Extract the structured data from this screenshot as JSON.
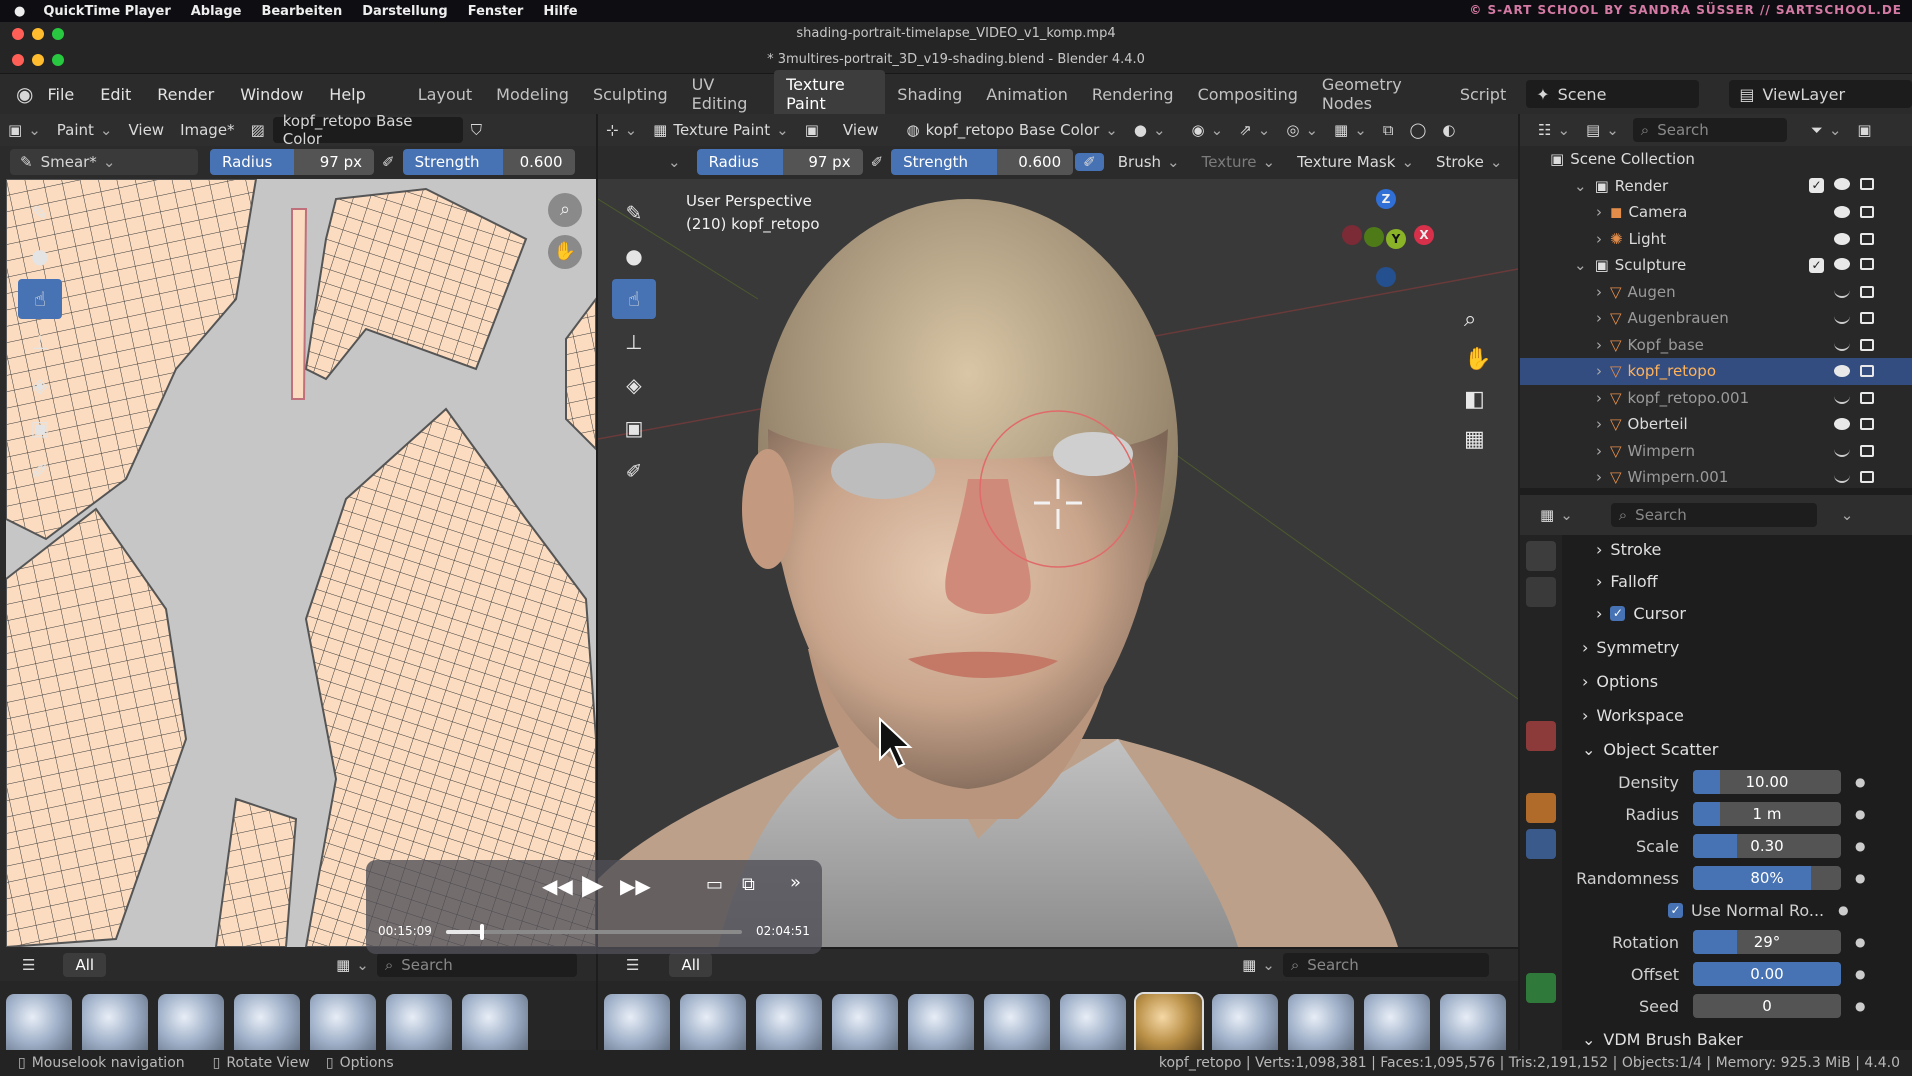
{
  "mac_menubar": {
    "app": "QuickTime Player",
    "items": [
      "Ablage",
      "Bearbeiten",
      "Darstellung",
      "Fenster",
      "Hilfe"
    ],
    "right_text": "© S-ART SCHOOL BY SANDRA SÜSSER // SARTSCHOOL.DE"
  },
  "window": {
    "video_title": "shading-portrait-timelapse_VIDEO_v1_komp.mp4",
    "blender_title": "* 3multires-portrait_3D_v19-shading.blend - Blender 4.4.0"
  },
  "topbar": {
    "menus": [
      "File",
      "Edit",
      "Render",
      "Window",
      "Help"
    ],
    "workspaces": [
      "Layout",
      "Modeling",
      "Sculpting",
      "UV Editing",
      "Texture Paint",
      "Shading",
      "Animation",
      "Rendering",
      "Compositing",
      "Geometry Nodes",
      "Script"
    ],
    "active_workspace": "Texture Paint",
    "scene": "Scene",
    "view_layer": "ViewLayer"
  },
  "image_editor": {
    "mode": "Paint",
    "view": "View",
    "image_menu": "Image*",
    "image_name": "kopf_retopo Base Color",
    "brush": "Smear*",
    "radius_label": "Radius",
    "radius_value": "97 px",
    "strength_label": "Strength",
    "strength_value": "0.600",
    "asset_filter": "All",
    "search_placeholder": "Search"
  },
  "viewport": {
    "mode": "Texture Paint",
    "view": "View",
    "texture": "kopf_retopo Base Color",
    "radius_label": "Radius",
    "radius_value": "97 px",
    "strength_label": "Strength",
    "strength_value": "0.600",
    "brush": "Brush",
    "texture_menu": "Texture",
    "texture_mask": "Texture Mask",
    "stroke": "Stroke",
    "perspective": "User Perspective",
    "object_info": "(210) kopf_retopo",
    "asset_filter": "All",
    "search_placeholder": "Search",
    "gizmo": {
      "x": "X",
      "y": "Y",
      "z": "Z"
    }
  },
  "player": {
    "current_time": "00:15:09",
    "total_time": "02:04:51",
    "progress": 0.12
  },
  "outliner": {
    "search_placeholder": "Search",
    "root": "Scene Collection",
    "items": [
      {
        "name": "Render",
        "type": "collection",
        "level": 1
      },
      {
        "name": "Camera",
        "type": "camera",
        "level": 2
      },
      {
        "name": "Light",
        "type": "light",
        "level": 2
      },
      {
        "name": "Sculpture",
        "type": "collection",
        "level": 1
      },
      {
        "name": "Augen",
        "type": "mesh",
        "level": 2,
        "hidden": true
      },
      {
        "name": "Augenbrauen",
        "type": "mesh",
        "level": 2,
        "hidden": true
      },
      {
        "name": "Kopf_base",
        "type": "mesh",
        "level": 2,
        "hidden": true
      },
      {
        "name": "kopf_retopo",
        "type": "mesh",
        "level": 2,
        "selected": true
      },
      {
        "name": "kopf_retopo.001",
        "type": "mesh",
        "level": 2,
        "hidden": true
      },
      {
        "name": "Oberteil",
        "type": "mesh",
        "level": 2
      },
      {
        "name": "Wimpern",
        "type": "mesh",
        "level": 2,
        "hidden": true
      },
      {
        "name": "Wimpern.001",
        "type": "mesh",
        "level": 2,
        "hidden": true
      }
    ]
  },
  "properties": {
    "search_placeholder": "Search",
    "sections": [
      "Stroke",
      "Falloff",
      "Cursor",
      "Symmetry",
      "Options",
      "Workspace",
      "Object Scatter"
    ],
    "scatter": [
      {
        "label": "Density",
        "value": "10.00",
        "fill": 0.18
      },
      {
        "label": "Radius",
        "value": "1 m",
        "fill": 0.18
      },
      {
        "label": "Scale",
        "value": "0.30",
        "fill": 0.3
      },
      {
        "label": "Randomness",
        "value": "80%",
        "fill": 0.8
      },
      {
        "label": "Use Normal Ro...",
        "checkbox": true
      },
      {
        "label": "Rotation",
        "value": "29°",
        "fill": 0.3
      },
      {
        "label": "Offset",
        "value": "0.00",
        "fill": 1.0
      },
      {
        "label": "Seed",
        "value": "0",
        "fill": 0
      }
    ],
    "next_section": "VDM Brush Baker"
  },
  "status": {
    "hint1": "Mouselook navigation",
    "hint2": "Rotate View",
    "hint3": "Options",
    "stats": "kopf_retopo | Verts:1,098,381 | Faces:1,095,576 | Tris:2,191,152 | Objects:1/4 | Memory: 925.3 MiB | 4.4.0"
  },
  "colors": {
    "accent_blue": "#4772b3",
    "skin": "#d9b8a0",
    "uv_island": "#fbdcc0",
    "selected_row": "#334d80"
  }
}
